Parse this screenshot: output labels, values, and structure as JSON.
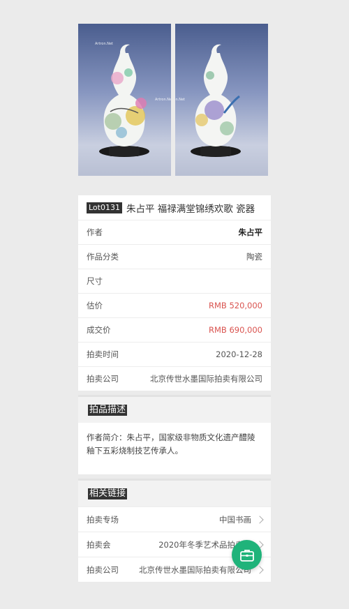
{
  "images": {
    "watermark": "Artron.Net"
  },
  "lot": {
    "badge": "Lot0131",
    "title": "朱占平 福禄满堂锦绣欢歌 瓷器"
  },
  "info_rows": [
    {
      "label": "作者",
      "value": "朱占平"
    },
    {
      "label": "作品分类",
      "value": "陶瓷"
    },
    {
      "label": "尺寸",
      "value": ""
    },
    {
      "label": "估价",
      "value": "RMB 520,000"
    },
    {
      "label": "成交价",
      "value": "RMB 690,000"
    },
    {
      "label": "拍卖时间",
      "value": "2020-12-28"
    },
    {
      "label": "拍卖公司",
      "value": "北京传世水墨国际拍卖有限公司"
    }
  ],
  "description": {
    "heading": "拍品描述",
    "text": "作者简介：朱占平，国家级非物质文化遗产醴陵釉下五彩烧制技艺传承人。"
  },
  "related": {
    "heading": "相关链接",
    "rows": [
      {
        "label": "拍卖专场",
        "value": "中国书画"
      },
      {
        "label": "拍卖会",
        "value": "2020年冬季艺术品拍卖会"
      },
      {
        "label": "拍卖公司",
        "value": "北京传世水墨国际拍卖有限公司"
      }
    ]
  },
  "colors": {
    "accent_green": "#1fb37a",
    "price_red": "#d9534f"
  },
  "icons": {
    "fab": "briefcase-icon",
    "row_arrow": "chevron-right-icon"
  }
}
